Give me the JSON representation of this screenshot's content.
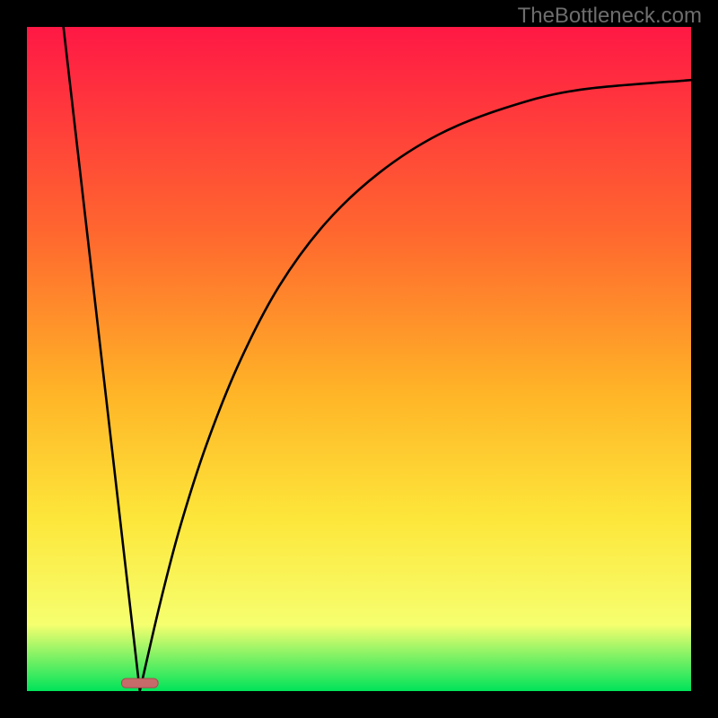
{
  "attribution": "TheBottleneck.com",
  "colors": {
    "frame": "#000000",
    "gradient_top": "#ff1845",
    "gradient_mid1": "#ff6a2e",
    "gradient_mid2": "#ffb427",
    "gradient_mid3": "#fde63a",
    "gradient_mid4": "#f6ff6f",
    "gradient_bottom": "#00e35a",
    "curve": "#000000",
    "marker_fill": "#c76a6a",
    "marker_stroke": "#a64f4f"
  },
  "chart_data": {
    "type": "line",
    "title": "",
    "xlabel": "",
    "ylabel": "",
    "x_range": [
      0,
      1
    ],
    "y_range": [
      0,
      1
    ],
    "description": "Bottleneck-style V curve: steep linear descent from top-left to a minimum near x≈0.17, then a rising concave curve approaching an asymptote near y≈0.92 at the right edge.",
    "minimum_x_fraction": 0.17,
    "right_asymptote_y_fraction": 0.92,
    "marker": {
      "x_center_fraction": 0.17,
      "y_center_fraction": 0.005,
      "width_fraction": 0.055,
      "height_fraction": 0.014
    },
    "series": [
      {
        "name": "left-descent",
        "segment": "line",
        "points": [
          {
            "x": 0.055,
            "y": 1.0
          },
          {
            "x": 0.17,
            "y": 0.0
          }
        ]
      },
      {
        "name": "right-ascent",
        "segment": "curve",
        "points": [
          {
            "x": 0.17,
            "y": 0.0
          },
          {
            "x": 0.2,
            "y": 0.13
          },
          {
            "x": 0.23,
            "y": 0.245
          },
          {
            "x": 0.27,
            "y": 0.37
          },
          {
            "x": 0.32,
            "y": 0.495
          },
          {
            "x": 0.38,
            "y": 0.61
          },
          {
            "x": 0.45,
            "y": 0.705
          },
          {
            "x": 0.53,
            "y": 0.78
          },
          {
            "x": 0.62,
            "y": 0.838
          },
          {
            "x": 0.72,
            "y": 0.878
          },
          {
            "x": 0.83,
            "y": 0.905
          },
          {
            "x": 1.0,
            "y": 0.92
          }
        ]
      }
    ]
  }
}
